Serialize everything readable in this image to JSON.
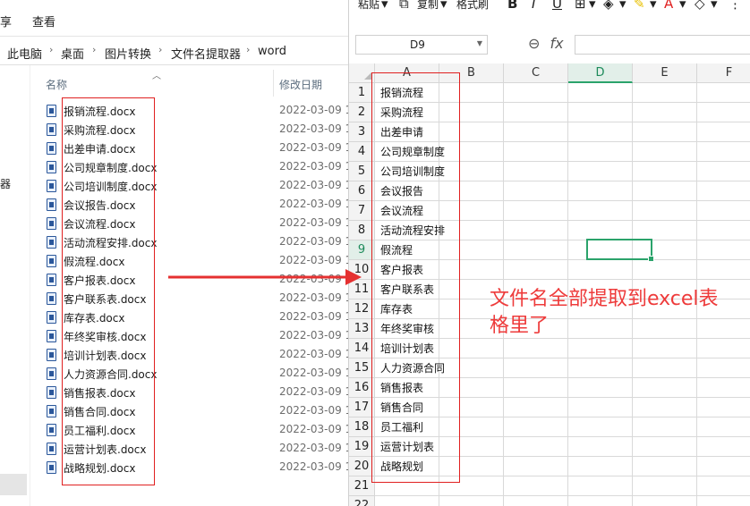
{
  "explorer": {
    "ribbon": {
      "share": "享",
      "view": "查看"
    },
    "breadcrumb": [
      "此电脑",
      "桌面",
      "图片转换",
      "文件名提取器",
      "word"
    ],
    "nav_fragment": "器",
    "columns": {
      "name": "名称",
      "modified": "修改日期"
    },
    "files": [
      {
        "name": "报销流程.docx",
        "date": "2022-03-09 1"
      },
      {
        "name": "采购流程.docx",
        "date": "2022-03-09 1"
      },
      {
        "name": "出差申请.docx",
        "date": "2022-03-09 1"
      },
      {
        "name": "公司规章制度.docx",
        "date": "2022-03-09 1"
      },
      {
        "name": "公司培训制度.docx",
        "date": "2022-03-09 1"
      },
      {
        "name": "会议报告.docx",
        "date": "2022-03-09 1"
      },
      {
        "name": "会议流程.docx",
        "date": "2022-03-09 1"
      },
      {
        "name": "活动流程安排.docx",
        "date": "2022-03-09 1"
      },
      {
        "name": "假流程.docx",
        "date": "2022-03-09 1"
      },
      {
        "name": "客户报表.docx",
        "date": "2022-03-09 1"
      },
      {
        "name": "客户联系表.docx",
        "date": "2022-03-09 1"
      },
      {
        "name": "库存表.docx",
        "date": "2022-03-09 1"
      },
      {
        "name": "年终奖审核.docx",
        "date": "2022-03-09 1"
      },
      {
        "name": "培训计划表.docx",
        "date": "2022-03-09 1"
      },
      {
        "name": "人力资源合同.docx",
        "date": "2022-03-09 1"
      },
      {
        "name": "销售报表.docx",
        "date": "2022-03-09 1"
      },
      {
        "name": "销售合同.docx",
        "date": "2022-03-09 1"
      },
      {
        "name": "员工福利.docx",
        "date": "2022-03-09 1"
      },
      {
        "name": "运营计划表.docx",
        "date": "2022-03-09 1"
      },
      {
        "name": "战略规划.docx",
        "date": "2022-03-09 1"
      }
    ]
  },
  "sheet": {
    "toolbar": {
      "paste": "粘贴",
      "copy": "复制",
      "format_painter": "格式刷",
      "bold": "B",
      "italic": "I",
      "underline": "U"
    },
    "name_box": "D9",
    "fx": "fx",
    "columns": [
      "A",
      "B",
      "C",
      "D",
      "E",
      "F"
    ],
    "active_column": "D",
    "active_row": 9,
    "rows": [
      {
        "n": "1",
        "a": "报销流程"
      },
      {
        "n": "2",
        "a": "采购流程"
      },
      {
        "n": "3",
        "a": "出差申请"
      },
      {
        "n": "4",
        "a": "公司规章制度"
      },
      {
        "n": "5",
        "a": "公司培训制度"
      },
      {
        "n": "6",
        "a": "会议报告"
      },
      {
        "n": "7",
        "a": "会议流程"
      },
      {
        "n": "8",
        "a": "活动流程安排"
      },
      {
        "n": "9",
        "a": "假流程"
      },
      {
        "n": "10",
        "a": "客户报表"
      },
      {
        "n": "11",
        "a": "客户联系表"
      },
      {
        "n": "12",
        "a": "库存表"
      },
      {
        "n": "13",
        "a": "年终奖审核"
      },
      {
        "n": "14",
        "a": "培训计划表"
      },
      {
        "n": "15",
        "a": "人力资源合同"
      },
      {
        "n": "16",
        "a": "销售报表"
      },
      {
        "n": "17",
        "a": "销售合同"
      },
      {
        "n": "18",
        "a": "员工福利"
      },
      {
        "n": "19",
        "a": "运营计划表"
      },
      {
        "n": "20",
        "a": "战略规划"
      },
      {
        "n": "21",
        "a": ""
      },
      {
        "n": "22",
        "a": ""
      }
    ]
  },
  "annotation": {
    "line1": "文件名全部提取到excel表",
    "line2": "格里了",
    "color": "#ee3b3b"
  },
  "colors": {
    "highlight_box": "#e02020",
    "selection": "#2ba36b",
    "arrow": "#e53030"
  }
}
